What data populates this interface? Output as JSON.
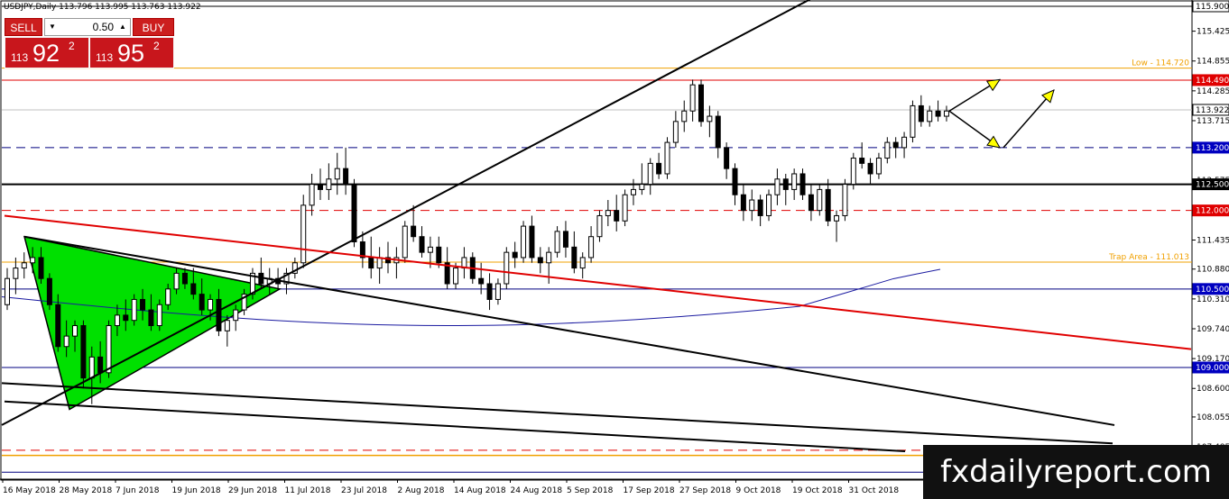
{
  "header": {
    "symbol_info": "USDJPY,Daily  113.796 113.995 113.763 113.922"
  },
  "trade_panel": {
    "sell_label": "SELL",
    "buy_label": "BUY",
    "lot": "0.50",
    "sell_price_small": "113",
    "sell_price_big": "92",
    "sell_price_sup": "2",
    "buy_price_small": "113",
    "buy_price_big": "95",
    "buy_price_sup": "2",
    "down_icon": "triangle-down-icon",
    "up_icon": "triangle-up-icon"
  },
  "watermark": "fxdailyreport.com",
  "colors": {
    "sell_red": "#cc1e1e",
    "resistance_red": "#e00000",
    "orange": "#f0a000",
    "navy": "#000080",
    "green_triangle": "#00e000",
    "arrow_yellow": "#ffff00",
    "ma_blue": "#1a1aa0"
  },
  "chart_data": {
    "type": "candlestick",
    "symbol": "USDJPY",
    "timeframe": "Daily",
    "ylim": [
      107.8,
      116.0
    ],
    "y_ticks": [
      "115.900",
      "115.425",
      "114.855",
      "114.285",
      "113.715",
      "113.145",
      "112.575",
      "112.000",
      "111.435",
      "110.880",
      "110.310",
      "109.740",
      "109.170",
      "108.600",
      "108.055",
      "107.485"
    ],
    "x_labels": [
      "16 May 2018",
      "28 May 2018",
      "7 Jun 2018",
      "19 Jun 2018",
      "29 Jun 2018",
      "11 Jul 2018",
      "23 Jul 2018",
      "2 Aug 2018",
      "14 Aug 2018",
      "24 Aug 2018",
      "5 Sep 2018",
      "17 Sep 2018",
      "27 Sep 2018",
      "9 Oct 2018",
      "19 Oct 2018",
      "31 Oct 2018"
    ],
    "levels": [
      {
        "price": 115.9,
        "label": "115.900",
        "color": "#000000",
        "style": "solid",
        "tag_bg": "#ffffff",
        "tag_fg": "#000000"
      },
      {
        "price": 114.72,
        "label": "Low - 114.720",
        "color": "#f0a000",
        "style": "solid",
        "tag_bg": "none",
        "tag_fg": "#f0a000"
      },
      {
        "price": 114.49,
        "label": "114.490",
        "color": "#e00000",
        "style": "solid",
        "tag_bg": "#e00000",
        "tag_fg": "#ffffff"
      },
      {
        "price": 113.922,
        "label": "113.922",
        "color": "#c0c0c0",
        "style": "solid",
        "tag_bg": "#ffffff",
        "tag_fg": "#000000"
      },
      {
        "price": 113.2,
        "label": "113.200",
        "color": "#000080",
        "style": "dashed",
        "tag_bg": "#0000c0",
        "tag_fg": "#ffffff"
      },
      {
        "price": 112.5,
        "label": "112.500",
        "color": "#000000",
        "style": "solid",
        "tag_bg": "#000000",
        "tag_fg": "#ffffff"
      },
      {
        "price": 112.0,
        "label": "112.000",
        "color": "#e00000",
        "style": "dashed",
        "tag_bg": "#e00000",
        "tag_fg": "#ffffff"
      },
      {
        "price": 111.013,
        "label": "Trap Area - 111.013",
        "color": "#f0a000",
        "style": "solid",
        "tag_bg": "none",
        "tag_fg": "#f0a000"
      },
      {
        "price": 110.5,
        "label": "110.500",
        "color": "#000080",
        "style": "solid",
        "tag_bg": "#0000c0",
        "tag_fg": "#ffffff"
      },
      {
        "price": 109.0,
        "label": "109.000",
        "color": "#000080",
        "style": "solid",
        "tag_bg": "#0000c0",
        "tag_fg": "#ffffff"
      }
    ],
    "candles": [
      [
        110.2,
        110.9,
        110.1,
        110.7
      ],
      [
        110.7,
        111.1,
        110.4,
        110.9
      ],
      [
        110.9,
        111.2,
        110.7,
        111.0
      ],
      [
        111.0,
        111.3,
        110.8,
        111.1
      ],
      [
        111.1,
        111.3,
        110.6,
        110.7
      ],
      [
        110.7,
        110.8,
        110.1,
        110.2
      ],
      [
        110.2,
        110.4,
        109.3,
        109.4
      ],
      [
        109.4,
        109.9,
        109.2,
        109.6
      ],
      [
        109.6,
        109.9,
        109.3,
        109.8
      ],
      [
        109.8,
        109.9,
        108.6,
        108.8
      ],
      [
        108.8,
        109.4,
        108.3,
        109.2
      ],
      [
        109.2,
        109.5,
        108.7,
        108.9
      ],
      [
        108.9,
        109.9,
        108.8,
        109.8
      ],
      [
        109.8,
        110.2,
        109.6,
        110.0
      ],
      [
        110.0,
        110.3,
        109.7,
        109.9
      ],
      [
        109.9,
        110.4,
        109.8,
        110.3
      ],
      [
        110.3,
        110.5,
        109.9,
        110.1
      ],
      [
        110.1,
        110.4,
        109.7,
        109.8
      ],
      [
        109.8,
        110.3,
        109.7,
        110.2
      ],
      [
        110.2,
        110.6,
        110.1,
        110.5
      ],
      [
        110.5,
        110.9,
        110.4,
        110.8
      ],
      [
        110.8,
        110.9,
        110.5,
        110.6
      ],
      [
        110.6,
        110.9,
        110.3,
        110.4
      ],
      [
        110.4,
        110.7,
        110.0,
        110.1
      ],
      [
        110.1,
        110.4,
        109.9,
        110.3
      ],
      [
        110.3,
        110.5,
        109.6,
        109.7
      ],
      [
        109.7,
        110.0,
        109.4,
        109.9
      ],
      [
        109.9,
        110.2,
        109.7,
        110.1
      ],
      [
        110.1,
        110.5,
        110.0,
        110.4
      ],
      [
        110.4,
        110.9,
        110.3,
        110.8
      ],
      [
        110.8,
        111.1,
        110.5,
        110.6
      ],
      [
        110.6,
        110.9,
        110.4,
        110.7
      ],
      [
        110.7,
        110.9,
        110.5,
        110.6
      ],
      [
        110.6,
        110.9,
        110.4,
        110.8
      ],
      [
        110.8,
        111.1,
        110.7,
        111.0
      ],
      [
        111.0,
        112.3,
        110.9,
        112.1
      ],
      [
        112.1,
        112.7,
        111.9,
        112.5
      ],
      [
        112.5,
        112.8,
        112.2,
        112.4
      ],
      [
        112.4,
        112.9,
        112.2,
        112.6
      ],
      [
        112.6,
        113.1,
        112.3,
        112.8
      ],
      [
        112.8,
        113.2,
        112.3,
        112.5
      ],
      [
        112.5,
        112.6,
        111.3,
        111.4
      ],
      [
        111.4,
        111.6,
        110.9,
        111.1
      ],
      [
        111.1,
        111.5,
        110.7,
        110.9
      ],
      [
        110.9,
        111.3,
        110.6,
        111.1
      ],
      [
        111.1,
        111.4,
        110.8,
        111.0
      ],
      [
        111.0,
        111.3,
        110.7,
        111.1
      ],
      [
        111.1,
        111.8,
        111.0,
        111.7
      ],
      [
        111.7,
        112.1,
        111.4,
        111.5
      ],
      [
        111.5,
        111.7,
        111.1,
        111.2
      ],
      [
        111.2,
        111.5,
        110.9,
        111.3
      ],
      [
        111.3,
        111.5,
        110.9,
        111.0
      ],
      [
        111.0,
        111.3,
        110.5,
        110.6
      ],
      [
        110.6,
        111.0,
        110.5,
        110.9
      ],
      [
        110.9,
        111.3,
        110.7,
        111.1
      ],
      [
        111.1,
        111.2,
        110.6,
        110.7
      ],
      [
        110.7,
        111.0,
        110.4,
        110.6
      ],
      [
        110.6,
        110.8,
        110.1,
        110.3
      ],
      [
        110.3,
        110.7,
        110.2,
        110.6
      ],
      [
        110.6,
        111.3,
        110.5,
        111.2
      ],
      [
        111.2,
        111.4,
        110.9,
        111.1
      ],
      [
        111.1,
        111.8,
        111.0,
        111.7
      ],
      [
        111.7,
        111.9,
        111.0,
        111.1
      ],
      [
        111.1,
        111.3,
        110.8,
        111.0
      ],
      [
        111.0,
        111.3,
        110.6,
        111.2
      ],
      [
        111.2,
        111.7,
        111.1,
        111.6
      ],
      [
        111.6,
        111.8,
        111.1,
        111.3
      ],
      [
        111.3,
        111.6,
        110.8,
        110.9
      ],
      [
        110.9,
        111.2,
        110.7,
        111.1
      ],
      [
        111.1,
        111.7,
        111.0,
        111.5
      ],
      [
        111.5,
        112.0,
        111.4,
        111.9
      ],
      [
        111.9,
        112.2,
        111.7,
        112.0
      ],
      [
        112.0,
        112.3,
        111.6,
        111.8
      ],
      [
        111.8,
        112.4,
        111.7,
        112.3
      ],
      [
        112.3,
        112.6,
        112.1,
        112.4
      ],
      [
        112.4,
        112.9,
        112.3,
        112.5
      ],
      [
        112.5,
        113.0,
        112.3,
        112.9
      ],
      [
        112.9,
        113.1,
        112.6,
        112.7
      ],
      [
        112.7,
        113.4,
        112.6,
        113.3
      ],
      [
        113.3,
        113.9,
        113.2,
        113.7
      ],
      [
        113.7,
        114.1,
        113.5,
        113.9
      ],
      [
        113.9,
        114.5,
        113.7,
        114.4
      ],
      [
        114.4,
        114.5,
        113.6,
        113.7
      ],
      [
        113.7,
        114.0,
        113.4,
        113.8
      ],
      [
        113.8,
        113.9,
        113.0,
        113.2
      ],
      [
        113.2,
        113.3,
        112.6,
        112.8
      ],
      [
        112.8,
        112.9,
        112.1,
        112.3
      ],
      [
        112.3,
        112.5,
        111.8,
        112.0
      ],
      [
        112.0,
        112.4,
        111.8,
        112.2
      ],
      [
        112.2,
        112.3,
        111.7,
        111.9
      ],
      [
        111.9,
        112.4,
        111.8,
        112.3
      ],
      [
        112.3,
        112.8,
        112.1,
        112.6
      ],
      [
        112.6,
        112.7,
        112.1,
        112.4
      ],
      [
        112.4,
        112.8,
        112.2,
        112.7
      ],
      [
        112.7,
        112.8,
        112.2,
        112.3
      ],
      [
        112.3,
        112.5,
        111.8,
        112.0
      ],
      [
        112.0,
        112.5,
        111.9,
        112.4
      ],
      [
        112.4,
        112.6,
        111.7,
        111.8
      ],
      [
        111.8,
        112.0,
        111.4,
        111.9
      ],
      [
        111.9,
        112.6,
        111.8,
        112.5
      ],
      [
        112.5,
        113.1,
        112.4,
        113.0
      ],
      [
        113.0,
        113.3,
        112.8,
        112.9
      ],
      [
        112.9,
        113.0,
        112.5,
        112.7
      ],
      [
        112.7,
        113.1,
        112.6,
        113.0
      ],
      [
        113.0,
        113.4,
        112.9,
        113.3
      ],
      [
        113.3,
        113.4,
        113.0,
        113.2
      ],
      [
        113.2,
        113.5,
        113.0,
        113.4
      ],
      [
        113.4,
        114.1,
        113.3,
        114.0
      ],
      [
        114.0,
        114.2,
        113.6,
        113.7
      ],
      [
        113.7,
        114.0,
        113.6,
        113.9
      ],
      [
        113.9,
        114.1,
        113.7,
        113.8
      ],
      [
        113.8,
        114.0,
        113.7,
        113.9
      ]
    ],
    "trendlines": [
      {
        "name": "upper-channel-line",
        "from": [
          2,
          107.9
        ],
        "to": [
          905,
          116.1
        ],
        "color": "#000000"
      },
      {
        "name": "lower-descending-line",
        "from": [
          2,
          108.7
        ],
        "to": [
          1233,
          107.55
        ],
        "color": "#000000"
      },
      {
        "name": "mid-descending-line",
        "from": [
          27,
          111.5
        ],
        "to": [
          1235,
          107.9
        ],
        "color": "#000000"
      },
      {
        "name": "bottom-descending-line",
        "from": [
          5,
          108.35
        ],
        "to": [
          1003,
          107.4
        ],
        "color": "#000000"
      },
      {
        "name": "red-descending-line",
        "from": [
          5,
          111.9
        ],
        "to": [
          1320,
          109.35
        ],
        "color": "#e00000"
      }
    ],
    "green_triangle": [
      [
        27,
        111.5
      ],
      [
        77,
        108.2
      ],
      [
        310,
        110.5
      ]
    ],
    "arrows": [
      {
        "from": [
          1052,
          113.9
        ],
        "to": [
          1108,
          114.5
        ]
      },
      {
        "from": [
          1052,
          113.9
        ],
        "to": [
          1108,
          113.2
        ]
      },
      {
        "from": [
          1112,
          113.2
        ],
        "to": [
          1168,
          114.3
        ]
      }
    ]
  }
}
